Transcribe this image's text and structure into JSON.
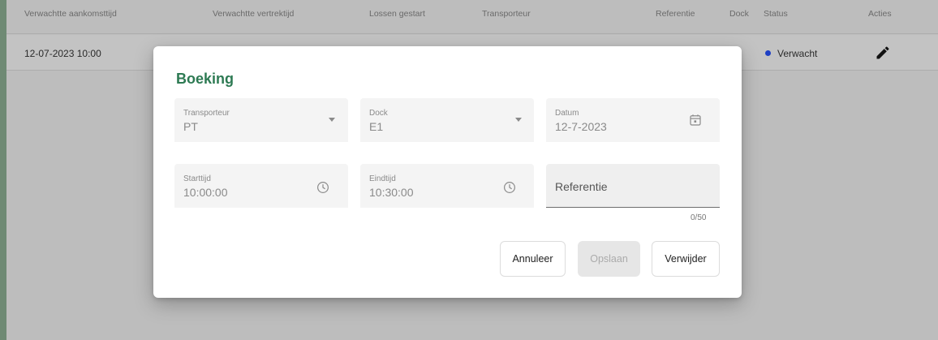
{
  "table": {
    "headers": {
      "arrival": "Verwachtte aankomsttijd",
      "departure": "Verwachtte vertrektijd",
      "unloading": "Lossen gestart",
      "carrier": "Transporteur",
      "reference": "Referentie",
      "dock": "Dock",
      "status": "Status",
      "actions": "Acties"
    },
    "rows": [
      {
        "arrival": "12-07-2023 10:00",
        "status": "Verwacht",
        "status_color": "#1e3fc4"
      }
    ]
  },
  "dialog": {
    "title": "Boeking",
    "carrier": {
      "label": "Transporteur",
      "value": "PT"
    },
    "dock": {
      "label": "Dock",
      "value": "E1"
    },
    "date": {
      "label": "Datum",
      "value": "12-7-2023"
    },
    "start": {
      "label": "Starttijd",
      "value": "10:00:00"
    },
    "end": {
      "label": "Eindtijd",
      "value": "10:30:00"
    },
    "reference": {
      "label": "Referentie",
      "counter": "0/50"
    },
    "buttons": {
      "cancel": "Annuleer",
      "save": "Opslaan",
      "delete": "Verwijder"
    }
  },
  "colors": {
    "title_green": "#2d7a53",
    "status_blue": "#1e3fc4"
  },
  "icons": {
    "edit": "pencil-icon",
    "calendar": "calendar-icon",
    "clock": "clock-icon",
    "dropdown": "chevron-down-icon"
  }
}
